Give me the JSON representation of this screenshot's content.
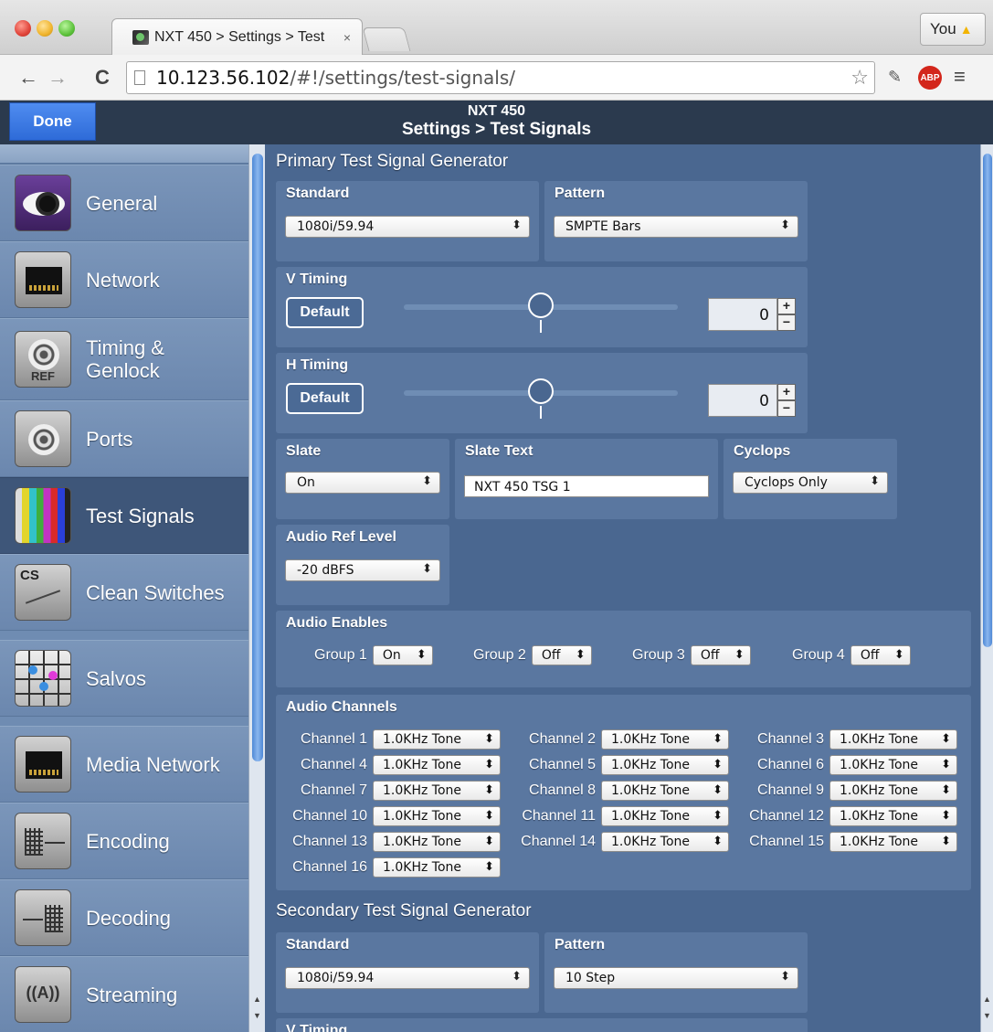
{
  "browser": {
    "tab_title": "NXT 450 > Settings > Test",
    "tab_close": "×",
    "profile_label": "You",
    "url_host": "10.123.56.102",
    "url_path": "/#!/settings/test-signals/",
    "abp_label": "ABP"
  },
  "header": {
    "done_label": "Done",
    "device_name": "NXT 450",
    "page_title": "Settings > Test Signals"
  },
  "sidebar": {
    "items": [
      {
        "label": "General",
        "icon": "eye-icon"
      },
      {
        "label": "Network",
        "icon": "ethernet-port-icon"
      },
      {
        "label": "Timing & Genlock",
        "icon": "ref-connector-icon"
      },
      {
        "label": "Ports",
        "icon": "bnc-port-icon"
      },
      {
        "label": "Test Signals",
        "icon": "color-bars-icon",
        "active": true
      },
      {
        "label": "Clean Switches",
        "icon": "clean-switch-icon"
      },
      {
        "label": "Salvos",
        "icon": "crosspoint-grid-icon"
      },
      {
        "label": "Media Network",
        "icon": "ethernet-port-icon"
      },
      {
        "label": "Encoding",
        "icon": "encoder-icon"
      },
      {
        "label": "Decoding",
        "icon": "decoder-icon"
      },
      {
        "label": "Streaming",
        "icon": "antenna-icon"
      }
    ]
  },
  "primary": {
    "title": "Primary Test Signal Generator",
    "standard_label": "Standard",
    "standard_value": "1080i/59.94",
    "pattern_label": "Pattern",
    "pattern_value": "SMPTE Bars",
    "vtiming_label": "V Timing",
    "vtiming_default": "Default",
    "vtiming_value": "0",
    "htiming_label": "H Timing",
    "htiming_default": "Default",
    "htiming_value": "0",
    "slate_label": "Slate",
    "slate_value": "On",
    "slate_text_label": "Slate Text",
    "slate_text_value": "NXT 450 TSG 1",
    "cyclops_label": "Cyclops",
    "cyclops_value": "Cyclops Only",
    "audio_ref_label": "Audio Ref Level",
    "audio_ref_value": "-20 dBFS",
    "audio_enables_label": "Audio Enables",
    "groups": [
      {
        "label": "Group 1",
        "value": "On"
      },
      {
        "label": "Group 2",
        "value": "Off"
      },
      {
        "label": "Group 3",
        "value": "Off"
      },
      {
        "label": "Group 4",
        "value": "Off"
      }
    ],
    "audio_channels_label": "Audio Channels",
    "channels": [
      {
        "label": "Channel 1",
        "value": "1.0KHz Tone"
      },
      {
        "label": "Channel 2",
        "value": "1.0KHz Tone"
      },
      {
        "label": "Channel 3",
        "value": "1.0KHz Tone"
      },
      {
        "label": "Channel 4",
        "value": "1.0KHz Tone"
      },
      {
        "label": "Channel 5",
        "value": "1.0KHz Tone"
      },
      {
        "label": "Channel 6",
        "value": "1.0KHz Tone"
      },
      {
        "label": "Channel 7",
        "value": "1.0KHz Tone"
      },
      {
        "label": "Channel 8",
        "value": "1.0KHz Tone"
      },
      {
        "label": "Channel 9",
        "value": "1.0KHz Tone"
      },
      {
        "label": "Channel 10",
        "value": "1.0KHz Tone"
      },
      {
        "label": "Channel 11",
        "value": "1.0KHz Tone"
      },
      {
        "label": "Channel 12",
        "value": "1.0KHz Tone"
      },
      {
        "label": "Channel 13",
        "value": "1.0KHz Tone"
      },
      {
        "label": "Channel 14",
        "value": "1.0KHz Tone"
      },
      {
        "label": "Channel 15",
        "value": "1.0KHz Tone"
      },
      {
        "label": "Channel 16",
        "value": "1.0KHz Tone"
      }
    ]
  },
  "secondary": {
    "title": "Secondary Test Signal Generator",
    "standard_label": "Standard",
    "standard_value": "1080i/59.94",
    "pattern_label": "Pattern",
    "pattern_value": "10 Step",
    "vtiming_label": "V Timing"
  },
  "glyphs": {
    "select_arrows": "⬍",
    "plus": "+",
    "minus": "−"
  },
  "colors": {
    "accent_done": "#2e6bd8",
    "sidebar_active": "#3e5679",
    "content_bg": "#4a6790",
    "panel_bg": "#5a77a0",
    "header_bg": "#2b3a4e"
  }
}
